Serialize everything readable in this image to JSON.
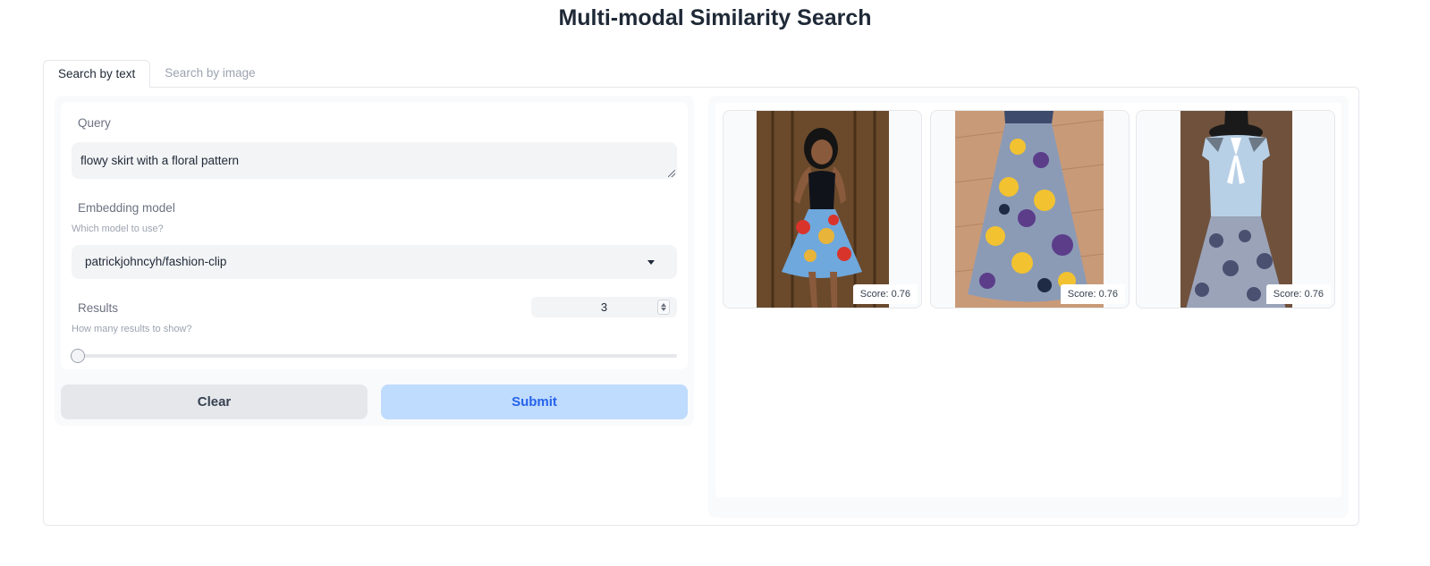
{
  "header": {
    "title": "Multi-modal Similarity Search"
  },
  "tabs": [
    {
      "label": "Search by text",
      "active": true
    },
    {
      "label": "Search by image",
      "active": false
    }
  ],
  "form": {
    "query": {
      "label": "Query",
      "value": "flowy skirt with a floral pattern"
    },
    "model": {
      "label": "Embedding model",
      "info": "Which model to use?",
      "selected": "patrickjohncyh/fashion-clip"
    },
    "results": {
      "label": "Results",
      "info": "How many results to show?",
      "value": "3",
      "slider_fraction": 0
    }
  },
  "buttons": {
    "clear": "Clear",
    "submit": "Submit"
  },
  "gallery": {
    "items": [
      {
        "caption": "Score: 0.76",
        "image": "woman-in-floral-skirt-photo"
      },
      {
        "caption": "Score: 0.76",
        "image": "floral-skirt-on-floor-photo"
      },
      {
        "caption": "Score: 0.76",
        "image": "blouse-and-skirt-on-mannequin-photo"
      }
    ]
  },
  "colors": {
    "primary": "#2563eb",
    "primary_soft": "#bfdbfe",
    "panel_bg": "#f9fafb"
  }
}
